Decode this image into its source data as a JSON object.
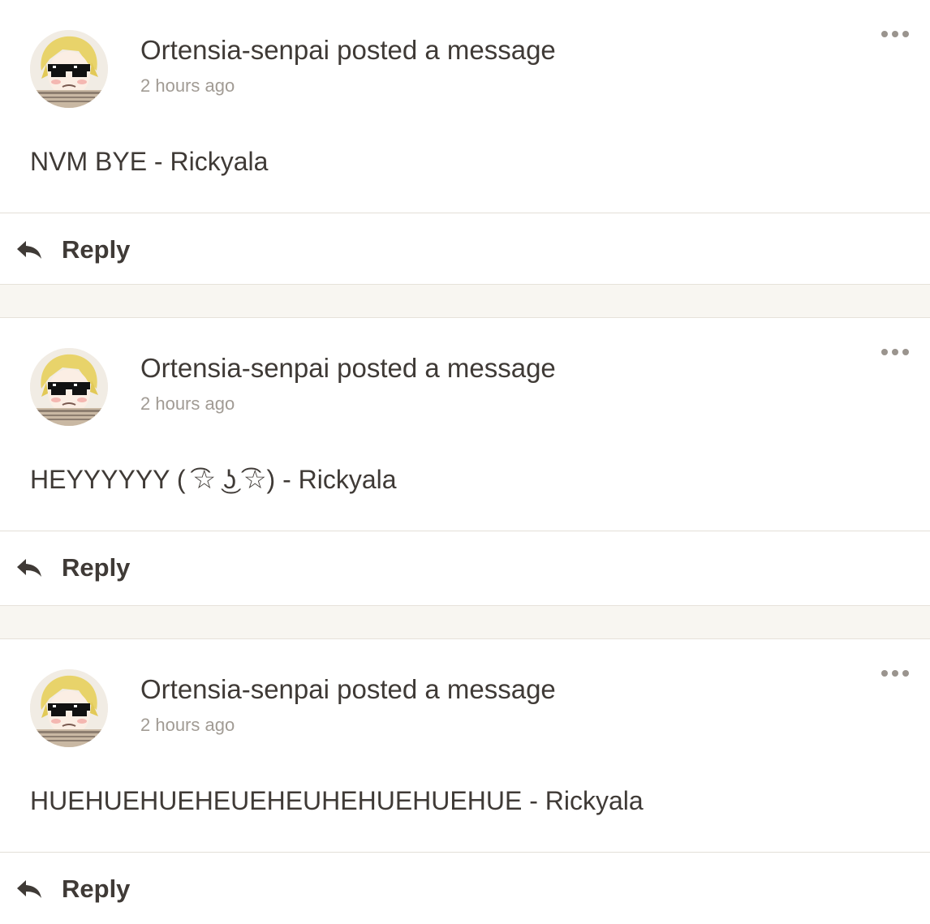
{
  "posts": [
    {
      "author_title": "Ortensia-senpai posted a message",
      "time": "2 hours ago",
      "message": "NVM BYE - Rickyala",
      "reply_label": "Reply",
      "avatar_icon": "user-avatar",
      "more_icon": "more-dots-icon"
    },
    {
      "author_title": "Ortensia-senpai posted a message",
      "time": "2 hours ago",
      "message": "HEYYYYYY ( ͡☆ ͜ʖ ͡☆) - Rickyala",
      "reply_label": "Reply",
      "avatar_icon": "user-avatar",
      "more_icon": "more-dots-icon"
    },
    {
      "author_title": "Ortensia-senpai posted a message",
      "time": "2 hours ago",
      "message": "HUEHUEHUEHEUEHEUHEHUEHUEHUE - Rickyala",
      "reply_label": "Reply",
      "avatar_icon": "user-avatar",
      "more_icon": "more-dots-icon"
    }
  ],
  "colors": {
    "text": "#3f3a36",
    "muted": "#a19b94",
    "separator_band": "#f8f6f1",
    "divider": "#e3dfd8"
  }
}
